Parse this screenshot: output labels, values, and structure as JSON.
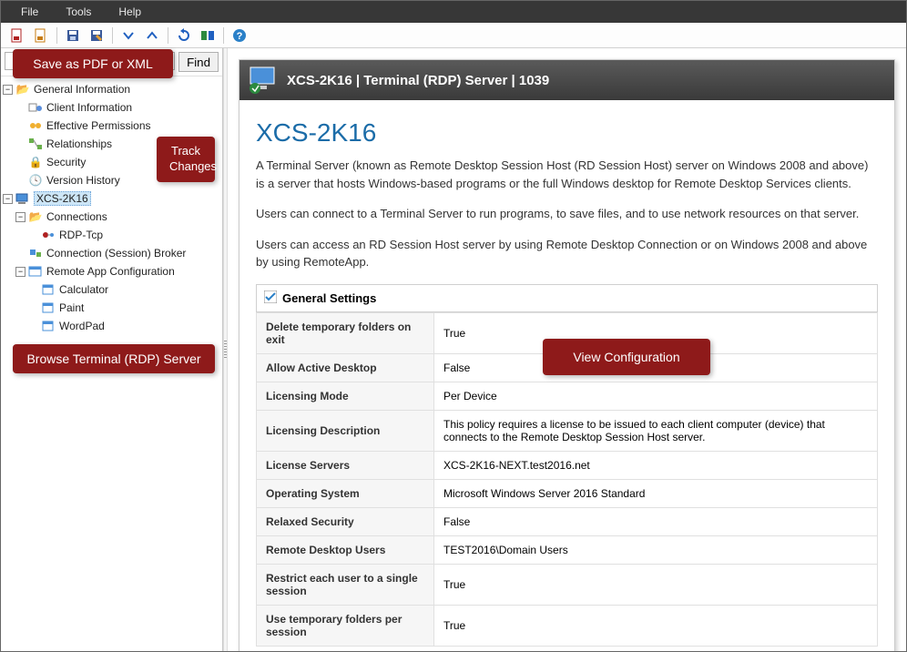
{
  "menu": {
    "file": "File",
    "tools": "Tools",
    "help": "Help"
  },
  "toolbar": {
    "pdf": "PDF",
    "xml": "XML",
    "save": "Save",
    "edit": "Edit",
    "down": "▾",
    "up": "▴",
    "refresh": "↻",
    "colors": "◧",
    "help": "?"
  },
  "search": {
    "placeholder": "",
    "find": "Find"
  },
  "tree": {
    "root": "General Information",
    "clientInfo": "Client Information",
    "effPerm": "Effective Permissions",
    "relationships": "Relationships",
    "security": "Security",
    "history": "Version History",
    "server": "XCS-2K16",
    "connections": "Connections",
    "rdpTcp": "RDP-Tcp",
    "sessionBroker": "Connection (Session) Broker",
    "remoteApp": "Remote App Configuration",
    "calc": "Calculator",
    "paint": "Paint",
    "wordpad": "WordPad"
  },
  "callouts": {
    "save": "Save as PDF or XML",
    "track": "Track Changes",
    "browse": "Browse Terminal (RDP) Server",
    "view": "View Configuration"
  },
  "header": {
    "title": "XCS-2K16 | Terminal (RDP) Server | 1039"
  },
  "page": {
    "title": "XCS-2K16",
    "p1": "A Terminal Server (known as Remote Desktop Session Host (RD Session Host) server on Windows 2008 and above) is a server that hosts Windows-based programs or the full Windows desktop for Remote Desktop Services clients.",
    "p2": "Users can connect to a Terminal Server to run programs, to save files, and to use network resources on that server.",
    "p3": "Users can access an RD Session Host server by using Remote Desktop Connection or on Windows 2008 and above by using RemoteApp."
  },
  "section": {
    "general": "General Settings"
  },
  "settings": [
    {
      "k": "Delete temporary folders on exit",
      "v": "True"
    },
    {
      "k": "Allow Active Desktop",
      "v": "False"
    },
    {
      "k": "Licensing Mode",
      "v": "Per Device"
    },
    {
      "k": "Licensing Description",
      "v": "This policy requires a license to be issued to each client computer (device) that connects to the Remote Desktop Session Host server."
    },
    {
      "k": "License Servers",
      "v": "XCS-2K16-NEXT.test2016.net"
    },
    {
      "k": "Operating System",
      "v": "Microsoft Windows Server 2016 Standard"
    },
    {
      "k": "Relaxed Security",
      "v": "False"
    },
    {
      "k": "Remote Desktop Users",
      "v": "TEST2016\\Domain Users"
    },
    {
      "k": "Restrict each user to a single session",
      "v": "True"
    },
    {
      "k": "Use temporary folders per session",
      "v": "True"
    }
  ]
}
